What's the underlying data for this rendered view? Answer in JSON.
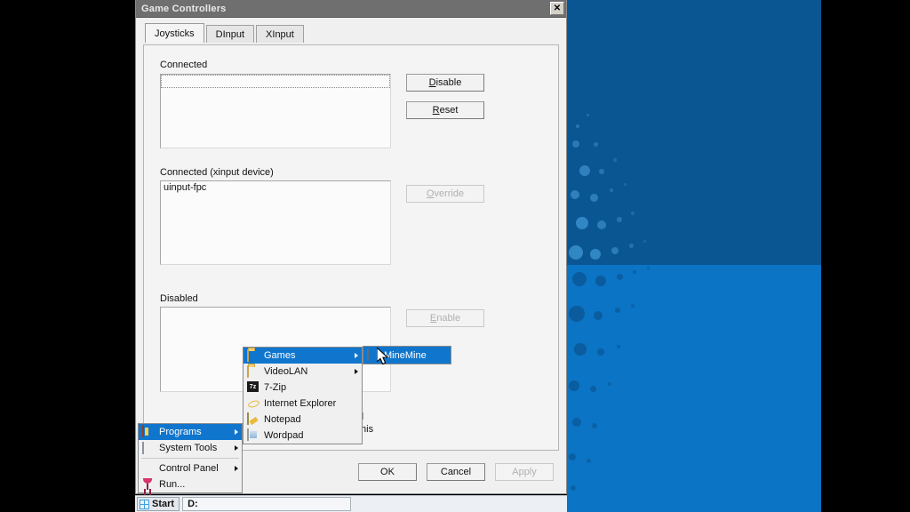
{
  "window": {
    "title": "Game Controllers",
    "close_label": "✕"
  },
  "tabs": [
    {
      "label": "Joysticks",
      "active": true
    },
    {
      "label": "DInput",
      "active": false
    },
    {
      "label": "XInput",
      "active": false
    }
  ],
  "groups": {
    "connected": {
      "label": "Connected",
      "items": [],
      "buttons": [
        {
          "label": "Disable",
          "accel": "D",
          "enabled": true
        },
        {
          "label": "Reset",
          "accel": "R",
          "enabled": true
        }
      ]
    },
    "connected_xinput": {
      "label": "Connected (xinput device)",
      "items": [
        "uinput-fpc"
      ],
      "buttons": [
        {
          "label": "Override",
          "accel": "O",
          "enabled": false
        }
      ]
    },
    "disabled": {
      "label": "Disabled",
      "items": [],
      "buttons": [
        {
          "label": "Enable",
          "accel": "E",
          "enabled": false
        }
      ]
    }
  },
  "hidden_text": {
    "line1": "d",
    "line2": "this"
  },
  "footer_buttons": [
    {
      "label": "OK",
      "enabled": true
    },
    {
      "label": "Cancel",
      "enabled": true
    },
    {
      "label": "Apply",
      "enabled": false
    }
  ],
  "start_menu": {
    "items": [
      {
        "label": "Programs",
        "icon": "programs-icon",
        "has_submenu": true,
        "selected": true
      },
      {
        "label": "System Tools",
        "icon": "system-tools-icon",
        "has_submenu": true,
        "selected": false
      },
      {
        "label": "Control Panel",
        "icon": "gear-icon",
        "has_submenu": true,
        "selected": false
      },
      {
        "label": "Run...",
        "icon": "run-icon",
        "has_submenu": false,
        "selected": false
      }
    ]
  },
  "programs_menu": {
    "items": [
      {
        "label": "Games",
        "icon": "folder-icon",
        "has_submenu": true,
        "selected": true
      },
      {
        "label": "VideoLAN",
        "icon": "folder-icon",
        "has_submenu": true,
        "selected": false
      },
      {
        "label": "7-Zip",
        "icon": "sevenzip-icon",
        "has_submenu": false,
        "selected": false
      },
      {
        "label": "Internet Explorer",
        "icon": "internet-explorer-icon",
        "has_submenu": false,
        "selected": false
      },
      {
        "label": "Notepad",
        "icon": "notepad-icon",
        "has_submenu": false,
        "selected": false
      },
      {
        "label": "Wordpad",
        "icon": "wordpad-icon",
        "has_submenu": false,
        "selected": false
      }
    ]
  },
  "games_menu": {
    "items": [
      {
        "label": "MineMine",
        "icon": "mine-icon",
        "has_submenu": false,
        "selected": true
      }
    ]
  },
  "taskbar": {
    "start_label": "Start",
    "task_label": "D:"
  },
  "colors": {
    "titlebar": "#6f6f6f",
    "menu_highlight": "#1076cd",
    "desktop_top": "#0a5693",
    "desktop_bottom": "#0b74c4",
    "dialog_face": "#f0f0f0"
  }
}
